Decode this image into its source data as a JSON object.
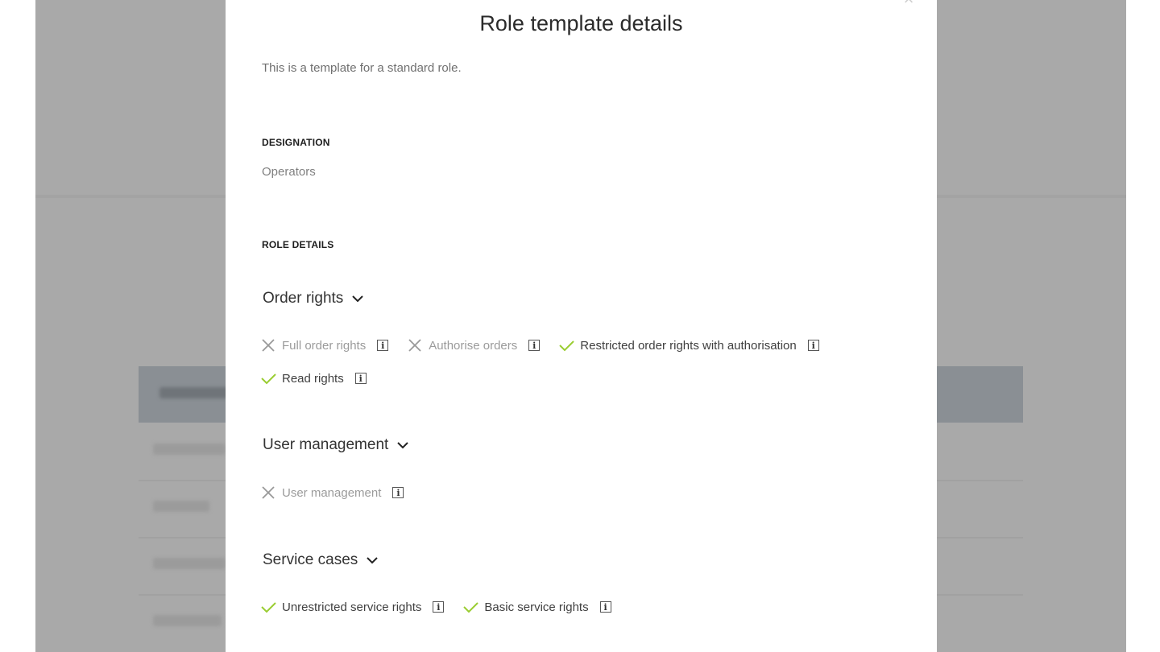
{
  "modal": {
    "title": "Role template details",
    "description": "This is a template for a standard role.",
    "designation_label": "DESIGNATION",
    "designation_value": "Operators",
    "role_details_label": "ROLE DETAILS"
  },
  "sections": [
    {
      "title": "Order rights",
      "rights": [
        {
          "label": "Full order rights",
          "granted": false
        },
        {
          "label": "Authorise orders",
          "granted": false
        },
        {
          "label": "Restricted order rights with authorisation",
          "granted": true
        },
        {
          "label": "Read rights",
          "granted": true
        }
      ]
    },
    {
      "title": "User management",
      "rights": [
        {
          "label": "User management",
          "granted": false
        }
      ]
    },
    {
      "title": "Service cases",
      "rights": [
        {
          "label": "Unrestricted service rights",
          "granted": true
        },
        {
          "label": "Basic service rights",
          "granted": true
        }
      ]
    }
  ],
  "icons": {
    "granted": "check-icon",
    "denied": "cross-icon",
    "info": "info-icon",
    "expand": "chevron-down-icon",
    "close": "close-icon"
  },
  "colors": {
    "check": "#9acd32",
    "cross": "#999999",
    "overlay": "#a9a9a9",
    "table_header": "#8a8f94"
  }
}
